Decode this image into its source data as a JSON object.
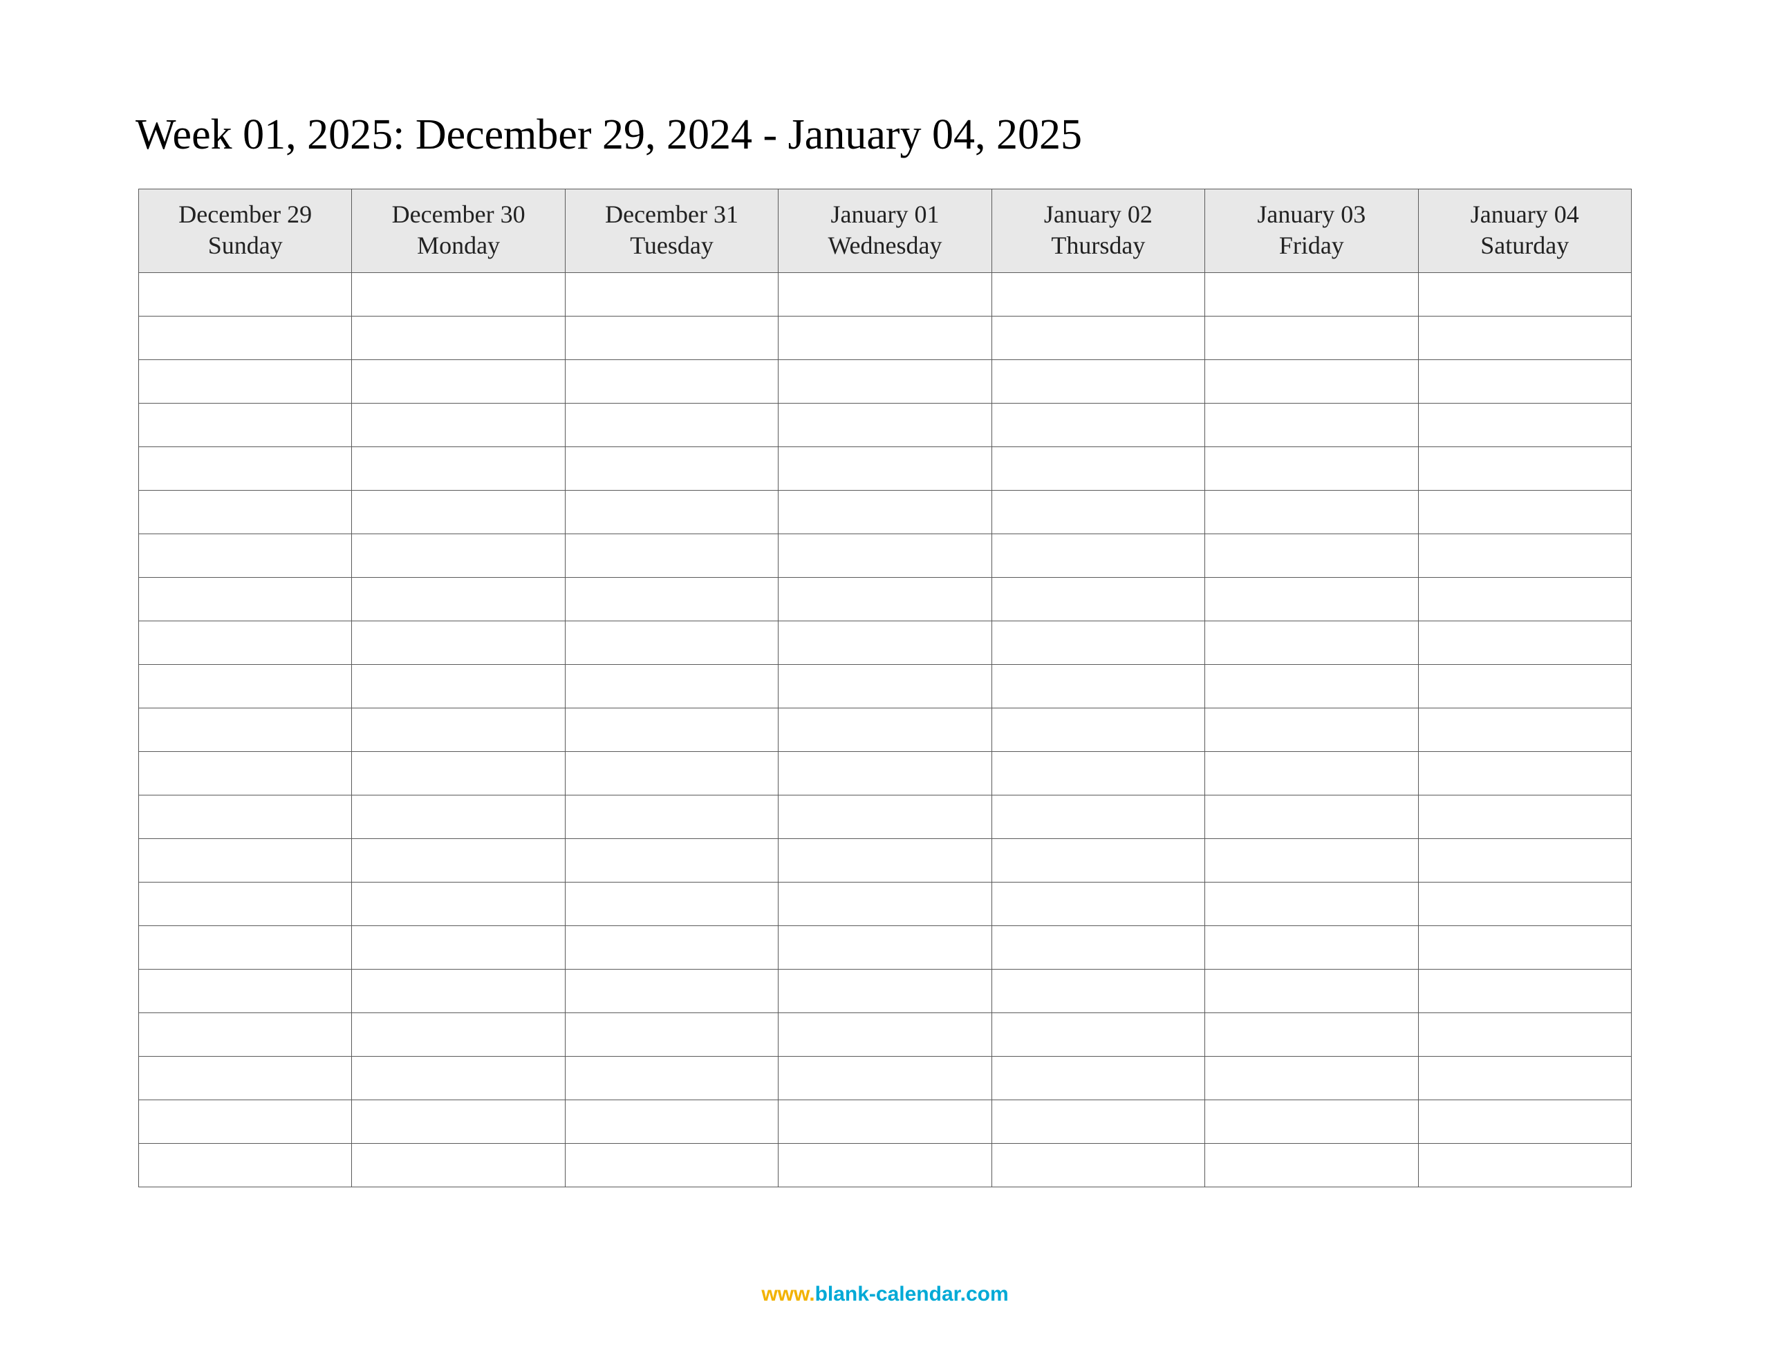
{
  "title": "Week 01, 2025: December 29, 2024 - January 04, 2025",
  "columns": [
    {
      "date": "December 29",
      "dow": "Sunday"
    },
    {
      "date": "December 30",
      "dow": "Monday"
    },
    {
      "date": "December 31",
      "dow": "Tuesday"
    },
    {
      "date": "January 01",
      "dow": "Wednesday"
    },
    {
      "date": "January 02",
      "dow": "Thursday"
    },
    {
      "date": "January 03",
      "dow": "Friday"
    },
    {
      "date": "January 04",
      "dow": "Saturday"
    }
  ],
  "body_rows": 21,
  "footer": {
    "www": "www",
    "dot": ".",
    "domain": "blank-calendar.com"
  }
}
